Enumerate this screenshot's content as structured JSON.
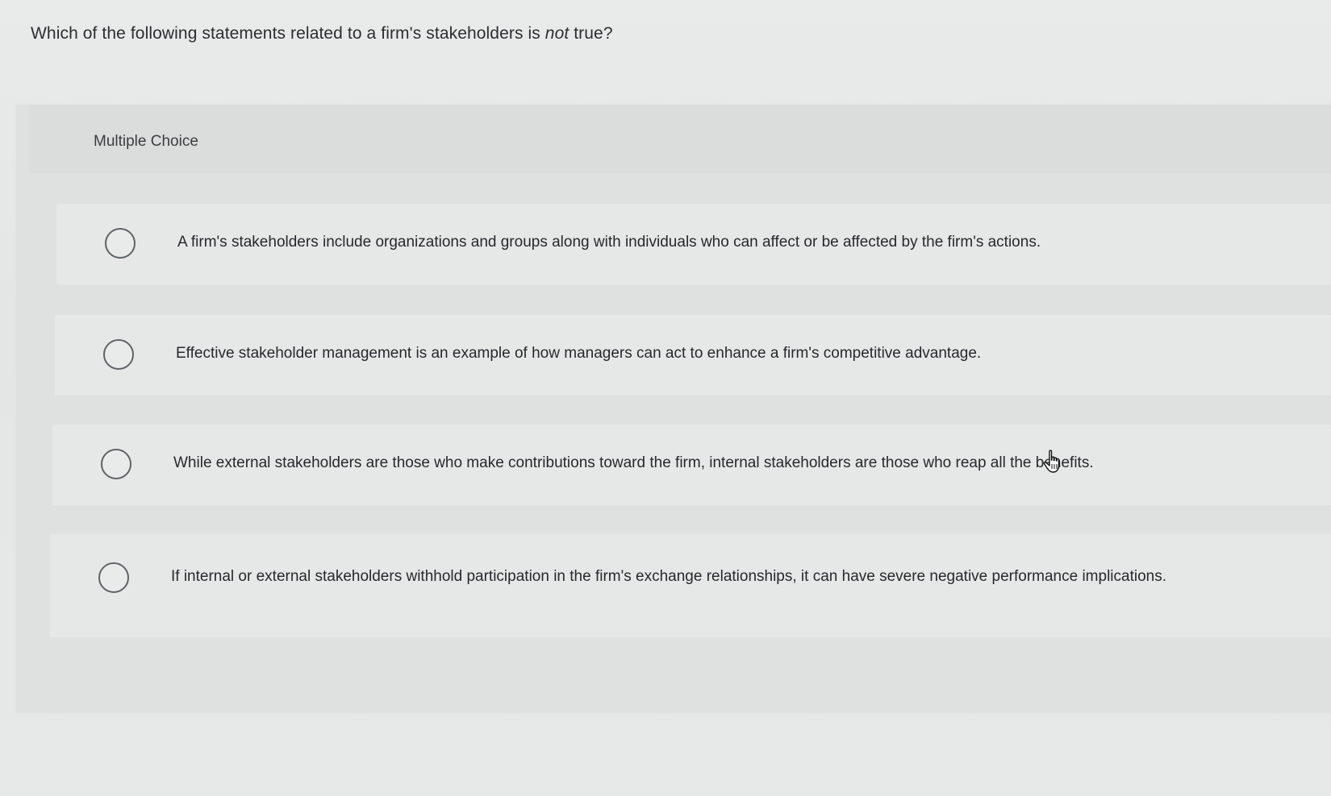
{
  "question": {
    "prefix": "Which of the following statements related to a firm's stakeholders is ",
    "emphasis": "not",
    "suffix": " true?"
  },
  "choice_panel": {
    "label": "Multiple Choice"
  },
  "options": [
    {
      "text": "A firm's stakeholders include organizations and groups along with individuals who can affect or be affected by the firm's actions.",
      "selected": false
    },
    {
      "text": "Effective stakeholder management is an example of how managers can act to enhance a firm's competitive advantage.",
      "selected": false
    },
    {
      "text": "While external stakeholders are those who make contributions toward the firm, internal stakeholders are those who reap all the benefits.",
      "selected": false
    },
    {
      "text": "If internal or external stakeholders withhold participation in the firm's exchange relationships, it can have severe negative performance implications.",
      "selected": false
    }
  ],
  "icons": {
    "radio": "radio-unchecked-icon",
    "cursor": "hand-pointer-cursor-icon"
  }
}
